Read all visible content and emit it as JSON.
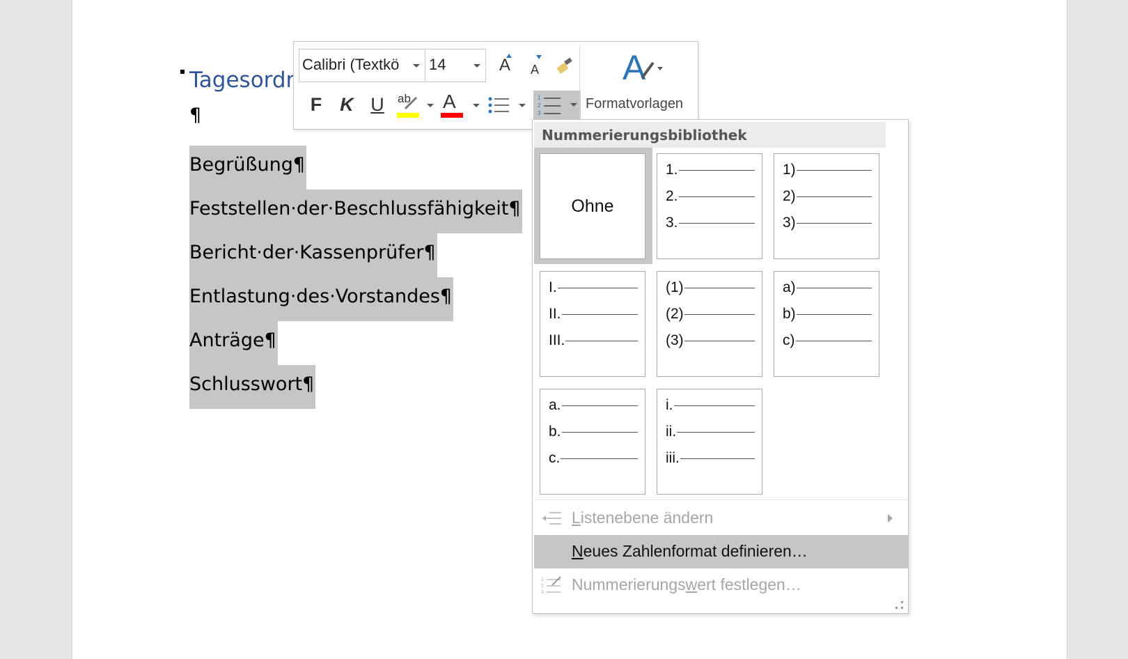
{
  "document": {
    "heading": "Tagesordn",
    "empty_paragraph": "¶",
    "paragraphs": [
      "Begrüßung¶",
      "Feststellen·der·Beschlussfähigkeit¶",
      "Bericht·der·Kassenprüfer¶",
      "Entlastung·des·Vorstandes¶",
      "Anträge¶",
      "Schlusswort¶"
    ]
  },
  "mini_toolbar": {
    "font_name": "Calibri (Textkö",
    "font_size": "14",
    "grow_font": "A",
    "shrink_font": "A",
    "bold": "F",
    "italic": "K",
    "underline": "U",
    "highlight_glyph": "ab",
    "font_color_glyph": "A",
    "styles_label": "Formatvorlagen",
    "colors": {
      "highlight": "#ffff00",
      "font_color": "#ff0000",
      "accent": "#2e75b6"
    }
  },
  "numbering_menu": {
    "header": "Nummerierungsbibliothek",
    "none_label": "Ohne",
    "formats": [
      [
        "1.",
        "2.",
        "3."
      ],
      [
        "1)",
        "2)",
        "3)"
      ],
      [
        "I.",
        "II.",
        "III."
      ],
      [
        "(1)",
        "(2)",
        "(3)"
      ],
      [
        "a)",
        "b)",
        "c)"
      ],
      [
        "a.",
        "b.",
        "c."
      ],
      [
        "i.",
        "ii.",
        "iii."
      ]
    ],
    "items": {
      "change_level": {
        "pre": "",
        "acc": "L",
        "post": "istenebene ändern",
        "disabled": true
      },
      "define_new": {
        "pre": "",
        "acc": "N",
        "post": "eues Zahlenformat definieren…",
        "highlighted": true
      },
      "set_value": {
        "pre": "Nummerierungs",
        "acc": "w",
        "post": "ert festlegen…",
        "disabled": true
      }
    }
  }
}
